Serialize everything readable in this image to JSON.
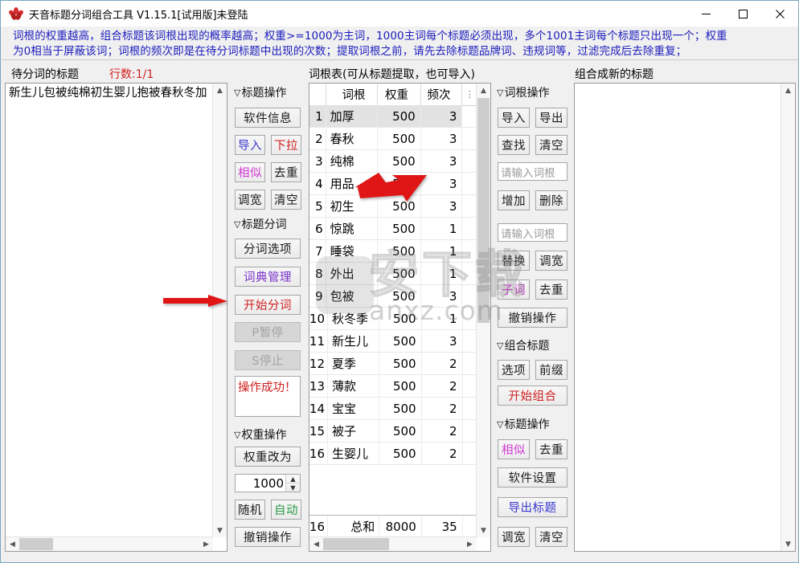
{
  "window": {
    "title": "天音标题分词组合工具 V1.15.1[试用版]未登陆",
    "icon": "flower-icon",
    "minimize": "–",
    "maximize": "□",
    "close": "✕"
  },
  "banner": {
    "line1": "词根的权重越高，组合标题该词根出现的概率越高；权重>=1000为主词，1000主词每个标题必须出现，多个1001主词每个标题只出现一个；权重",
    "line2": "为0相当于屏蔽该词；词根的频次即是在待分词标题中出现的次数；提取词根之前，请先去除标题品牌词、违规词等，过滤完成后去除重复；",
    "color": "#1b1bbd"
  },
  "left_panel": {
    "header": "待分词的标题",
    "row_count_label": "行数:1/1",
    "row_count_color": "#d02020",
    "textarea_value": "新生儿包被纯棉初生婴儿抱被春秋冬加"
  },
  "middle_toolbar": {
    "group1": {
      "label": "标题操作",
      "triangle": "▽"
    },
    "software_info": "软件信息",
    "import": {
      "label": "导入",
      "color": "#3a3ad0"
    },
    "dropdown": {
      "label": "下拉",
      "color": "#d02020"
    },
    "similar": {
      "label": "相似",
      "color": "#d23ad2"
    },
    "dedupe": {
      "label": "去重",
      "color": "#1a1a1a"
    },
    "widen": "调宽",
    "clear": "清空",
    "group2": {
      "label": "标题分词",
      "triangle": "▽"
    },
    "seg_options": "分词选项",
    "dict_manage": {
      "label": "词典管理",
      "color": "#7b34c8"
    },
    "start_seg": {
      "label": "开始分词",
      "color": "#d02020"
    },
    "pause": {
      "label": "P暂停",
      "disabled": true
    },
    "stop": {
      "label": "S停止",
      "disabled": true
    },
    "status_text": "操作成功！",
    "status_color": "#d02020",
    "group3": {
      "label": "权重操作",
      "triangle": "▽"
    },
    "weight_change_to": "权重改为",
    "weight_value": "1000",
    "random": "随机",
    "auto": {
      "label": "自动",
      "color": "#2a9a45"
    },
    "undo": "撤销操作"
  },
  "grid_panel": {
    "header": "词根表(可从标题提取，也可导入)",
    "columns": [
      "",
      "词根",
      "权重",
      "频次",
      "⋮"
    ],
    "rows": [
      {
        "idx": "1",
        "word": "加厚",
        "weight": "500",
        "freq": "3",
        "selected": true
      },
      {
        "idx": "2",
        "word": "春秋",
        "weight": "500",
        "freq": "3"
      },
      {
        "idx": "3",
        "word": "纯棉",
        "weight": "500",
        "freq": "3"
      },
      {
        "idx": "4",
        "word": "用品",
        "weight": "500",
        "freq": "3"
      },
      {
        "idx": "5",
        "word": "初生",
        "weight": "500",
        "freq": "3"
      },
      {
        "idx": "6",
        "word": "惊跳",
        "weight": "500",
        "freq": "1"
      },
      {
        "idx": "7",
        "word": "睡袋",
        "weight": "500",
        "freq": "1"
      },
      {
        "idx": "8",
        "word": "外出",
        "weight": "500",
        "freq": "1"
      },
      {
        "idx": "9",
        "word": "包被",
        "weight": "500",
        "freq": "3"
      },
      {
        "idx": "10",
        "word": "秋冬季",
        "weight": "500",
        "freq": "1"
      },
      {
        "idx": "11",
        "word": "新生儿",
        "weight": "500",
        "freq": "3"
      },
      {
        "idx": "12",
        "word": "夏季",
        "weight": "500",
        "freq": "2"
      },
      {
        "idx": "13",
        "word": "薄款",
        "weight": "500",
        "freq": "2"
      },
      {
        "idx": "14",
        "word": "宝宝",
        "weight": "500",
        "freq": "2"
      },
      {
        "idx": "15",
        "word": "被子",
        "weight": "500",
        "freq": "2"
      },
      {
        "idx": "16",
        "word": "生婴儿",
        "weight": "500",
        "freq": "2"
      }
    ],
    "total": {
      "idx": "16",
      "word": "总和",
      "weight": "8000",
      "freq": "35"
    }
  },
  "right_toolbar": {
    "group1": {
      "label": "词根操作",
      "triangle": "▽"
    },
    "import": "导入",
    "export": "导出",
    "find": "查找",
    "clear": "清空",
    "input1_placeholder": "请输入词根",
    "add": "增加",
    "delete": "删除",
    "input2_placeholder": "请输入词根",
    "replace": "替换",
    "widen": "调宽",
    "subword": {
      "label": "子词",
      "color": "#d23ad2"
    },
    "dedupe": "去重",
    "undo": "撤销操作",
    "group2": {
      "label": "组合标题",
      "triangle": "▽"
    },
    "options": "选项",
    "prefix": "前缀",
    "start_combine": {
      "label": "开始组合",
      "color": "#d02020"
    },
    "group3": {
      "label": "标题操作",
      "triangle": "▽"
    },
    "similar": {
      "label": "相似",
      "color": "#d23ad2"
    },
    "dedupe2": "去重",
    "software_settings": "软件设置",
    "export_titles": {
      "label": "导出标题",
      "color": "#3a3ad0"
    },
    "widen2": "调宽",
    "clear2": "清空"
  },
  "right_panel": {
    "header": "组合成新的标题",
    "textarea_value": ""
  },
  "watermark": {
    "big": "安下载",
    "small": "anxz.com"
  }
}
